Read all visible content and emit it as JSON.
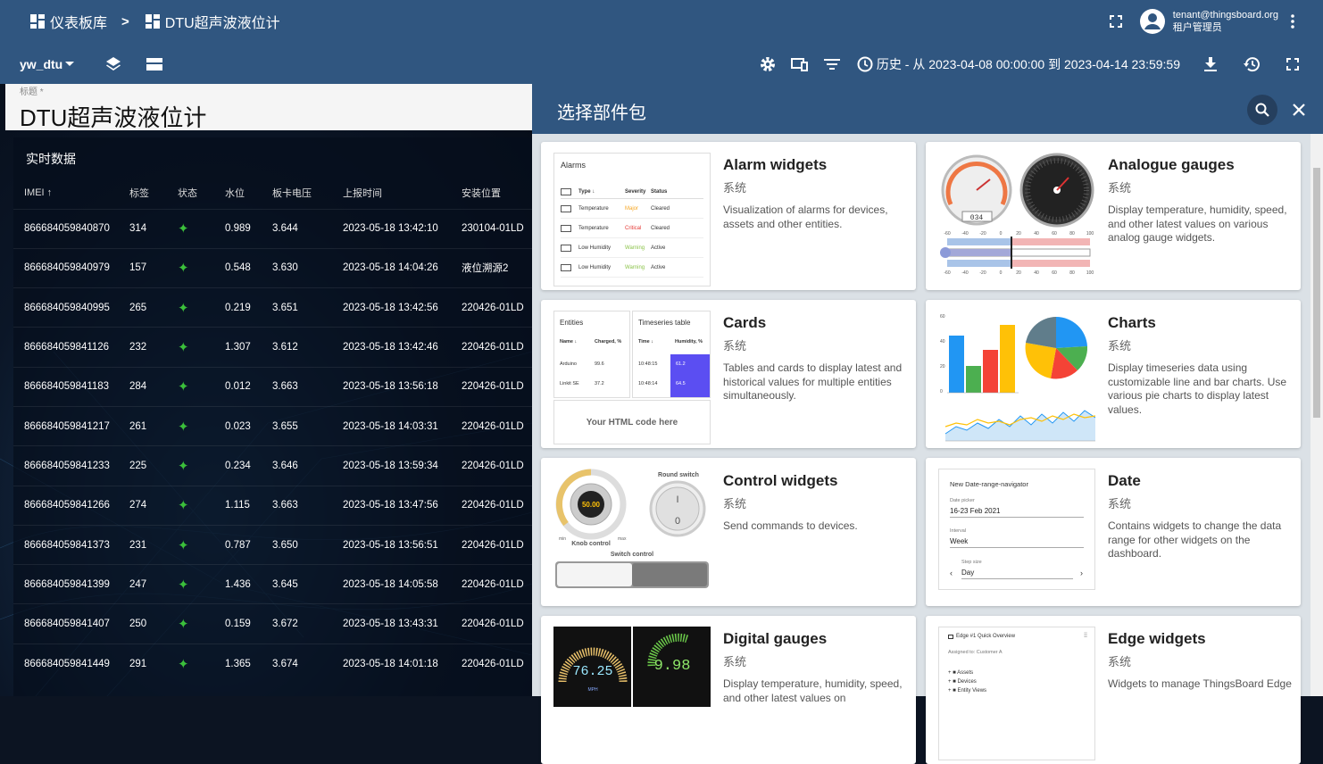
{
  "header": {
    "breadcrumb_root": "仪表板库",
    "breadcrumb_sep": ">",
    "breadcrumb_current": "DTU超声波液位计",
    "user_email": "tenant@thingsboard.org",
    "user_role": "租户管理员"
  },
  "toolbar": {
    "state": "yw_dtu",
    "time_window": "历史 - 从 2023-04-08 00:00:00 到 2023-04-14 23:59:59"
  },
  "dashboard": {
    "title_label": "标题 *",
    "title_value": "DTU超声波液位计",
    "table_title": "实时数据",
    "columns": [
      "IMEI ↑",
      "标签",
      "状态",
      "水位",
      "板卡电压",
      "上报时间",
      "安装位置"
    ],
    "rows": [
      [
        "866684059840870",
        "314",
        "✦",
        "0.989",
        "3.644",
        "2023-05-18 13:42:10",
        "230104-01LD"
      ],
      [
        "866684059840979",
        "157",
        "✦",
        "0.548",
        "3.630",
        "2023-05-18 14:04:26",
        "液位溯源2"
      ],
      [
        "866684059840995",
        "265",
        "✦",
        "0.219",
        "3.651",
        "2023-05-18 13:42:56",
        "220426-01LD"
      ],
      [
        "866684059841126",
        "232",
        "✦",
        "1.307",
        "3.612",
        "2023-05-18 13:42:46",
        "220426-01LD"
      ],
      [
        "866684059841183",
        "284",
        "✦",
        "0.012",
        "3.663",
        "2023-05-18 13:56:18",
        "220426-01LD"
      ],
      [
        "866684059841217",
        "261",
        "✦",
        "0.023",
        "3.655",
        "2023-05-18 14:03:31",
        "220426-01LD"
      ],
      [
        "866684059841233",
        "225",
        "✦",
        "0.234",
        "3.646",
        "2023-05-18 13:59:34",
        "220426-01LD"
      ],
      [
        "866684059841266",
        "274",
        "✦",
        "1.115",
        "3.663",
        "2023-05-18 13:47:56",
        "220426-01LD"
      ],
      [
        "866684059841373",
        "231",
        "✦",
        "0.787",
        "3.650",
        "2023-05-18 13:56:51",
        "220426-01LD"
      ],
      [
        "866684059841399",
        "247",
        "✦",
        "1.436",
        "3.645",
        "2023-05-18 14:05:58",
        "220426-01LD"
      ],
      [
        "866684059841407",
        "250",
        "✦",
        "0.159",
        "3.672",
        "2023-05-18 13:43:31",
        "220426-01LD"
      ],
      [
        "866684059841449",
        "291",
        "✦",
        "1.365",
        "3.674",
        "2023-05-18 14:01:18",
        "220426-01LD"
      ]
    ]
  },
  "panel": {
    "title": "选择部件包",
    "bundles": [
      {
        "title": "Alarm widgets",
        "system": "系统",
        "desc": "Visualization of alarms for devices, assets and other entities."
      },
      {
        "title": "Analogue gauges",
        "system": "系统",
        "desc": "Display temperature, humidity, speed, and other latest values on various analog gauge widgets."
      },
      {
        "title": "Cards",
        "system": "系统",
        "desc": "Tables and cards to display latest and historical values for multiple entities simultaneously."
      },
      {
        "title": "Charts",
        "system": "系统",
        "desc": "Display timeseries data using customizable line and bar charts. Use various pie charts to display latest values."
      },
      {
        "title": "Control widgets",
        "system": "系统",
        "desc": "Send commands to devices."
      },
      {
        "title": "Date",
        "system": "系统",
        "desc": "Contains widgets to change the data range for other widgets on the dashboard."
      },
      {
        "title": "Digital gauges",
        "system": "系统",
        "desc": "Display temperature, humidity, speed, and other latest values on"
      },
      {
        "title": "Edge widgets",
        "system": "系统",
        "desc": "Widgets to manage ThingsBoard Edge"
      }
    ],
    "previews": {
      "alarm": {
        "title": "Alarms",
        "headers": [
          "Type ↓",
          "Severity",
          "Status"
        ],
        "rows": [
          [
            "Temperature",
            "Major",
            "Cleared"
          ],
          [
            "Temperature",
            "Critical",
            "Cleared"
          ],
          [
            "Low Humidity",
            "Warning",
            "Active"
          ],
          [
            "Low Humidity",
            "Warning",
            "Active"
          ]
        ]
      },
      "cards": {
        "entities": "Entities",
        "timeseries": "Timeseries table",
        "h_name": "Name ↓",
        "h_charged": "Charged, %",
        "h_time": "Time ↓",
        "h_humidity": "Humidity, %",
        "r1": [
          "Arduino",
          "99.6",
          "10:48:15",
          "61.2"
        ],
        "r2": [
          "Linkit SE",
          "37.2",
          "10:48:14",
          "64.5"
        ],
        "html": "Your HTML code here"
      },
      "control": {
        "knob_value": "50.00",
        "knob_label": "Knob control",
        "min": "min",
        "max": "max",
        "round_switch": "Round switch",
        "switch_control": "Switch control",
        "on": "I",
        "off": "0"
      },
      "date": {
        "title": "New Date-range-navigator",
        "picker_label": "Date picker",
        "picker_value": "16-23 Feb 2021",
        "interval_label": "Interval",
        "interval_value": "Week",
        "step_label": "Step size",
        "step_value": "Day"
      },
      "digital": {
        "left_value": "76.25",
        "right_value": "9.98",
        "unit": "MPH"
      },
      "edge": {
        "title": "Edge #1 Quick Overview",
        "assigned": "Assigned to: Customer A",
        "items": [
          "Assets",
          "Devices",
          "Entity Views"
        ]
      },
      "analogue": {
        "odometer": "034",
        "scale": [
          "-60",
          "-40",
          "-20",
          "0",
          "20",
          "40",
          "60",
          "80",
          "100"
        ]
      },
      "charts": {
        "ticks": [
          "60",
          "40",
          "20",
          "0"
        ]
      }
    }
  }
}
